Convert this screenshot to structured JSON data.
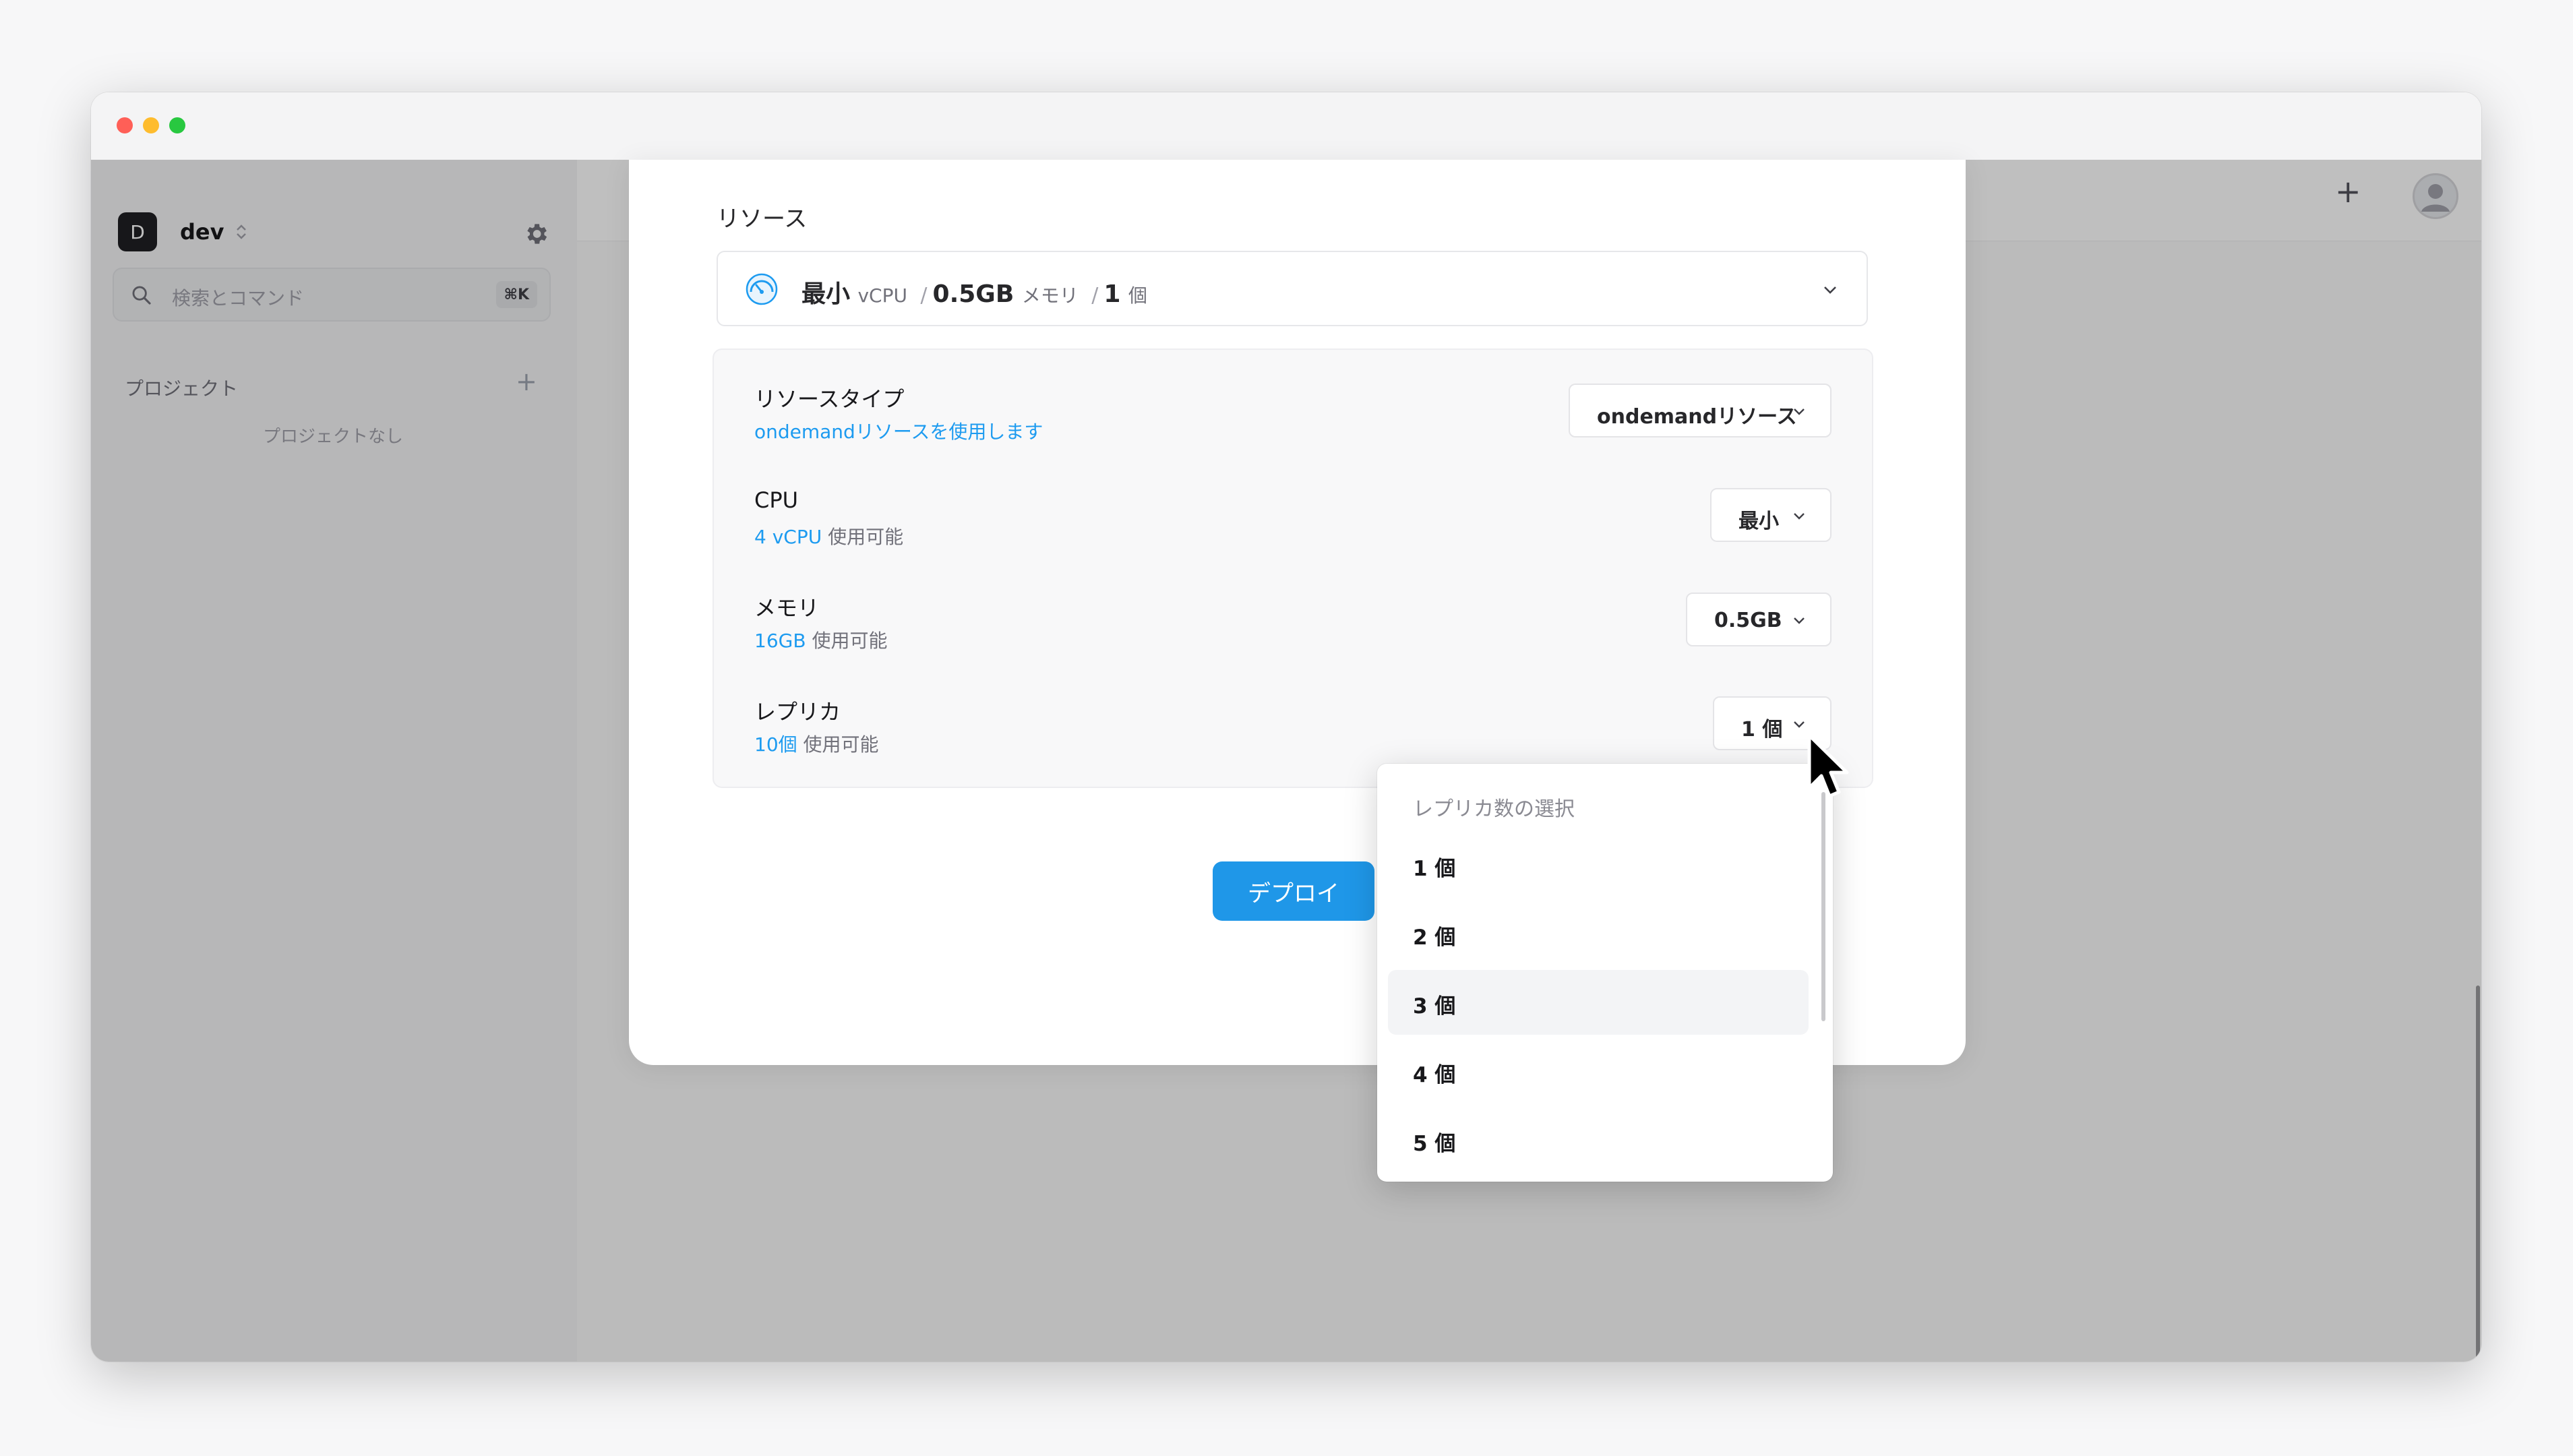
{
  "window": {
    "traffic_lights": [
      "close",
      "minimize",
      "maximize"
    ]
  },
  "sidebar": {
    "workspace": {
      "badge": "D",
      "name": "dev"
    },
    "search": {
      "placeholder": "検索とコマンド",
      "shortcut": "⌘K"
    },
    "projects": {
      "title": "プロジェクト",
      "empty": "プロジェクトなし"
    }
  },
  "header": {
    "add_icon": "plus-icon",
    "avatar_icon": "user-icon"
  },
  "modal": {
    "section_title": "リソース",
    "summary": {
      "cpu": "最小",
      "cpu_unit": "vCPU",
      "memory": "0.5GB",
      "memory_unit": "メモリ",
      "replicas": "1",
      "replicas_unit": "個",
      "separator": "/"
    },
    "rows": [
      {
        "label": "リソースタイプ",
        "sub_value": "ondemandリソースを使用します",
        "sub_suffix": "",
        "select": "ondemandリソース"
      },
      {
        "label": "CPU",
        "sub_value": "4 vCPU",
        "sub_suffix": "使用可能",
        "select": "最小"
      },
      {
        "label": "メモリ",
        "sub_value": "16GB",
        "sub_suffix": "使用可能",
        "select": "0.5GB"
      },
      {
        "label": "レプリカ",
        "sub_value": "10個",
        "sub_suffix": "使用可能",
        "select": "1 個"
      }
    ],
    "deploy_button": "デプロイ"
  },
  "dropdown": {
    "header": "レプリカ数の選択",
    "options": [
      "1 個",
      "2 個",
      "3 個",
      "4 個",
      "5 個"
    ],
    "highlighted": "3 個"
  },
  "colors": {
    "accent": "#1f97e8",
    "link": "#1d9bf0"
  }
}
